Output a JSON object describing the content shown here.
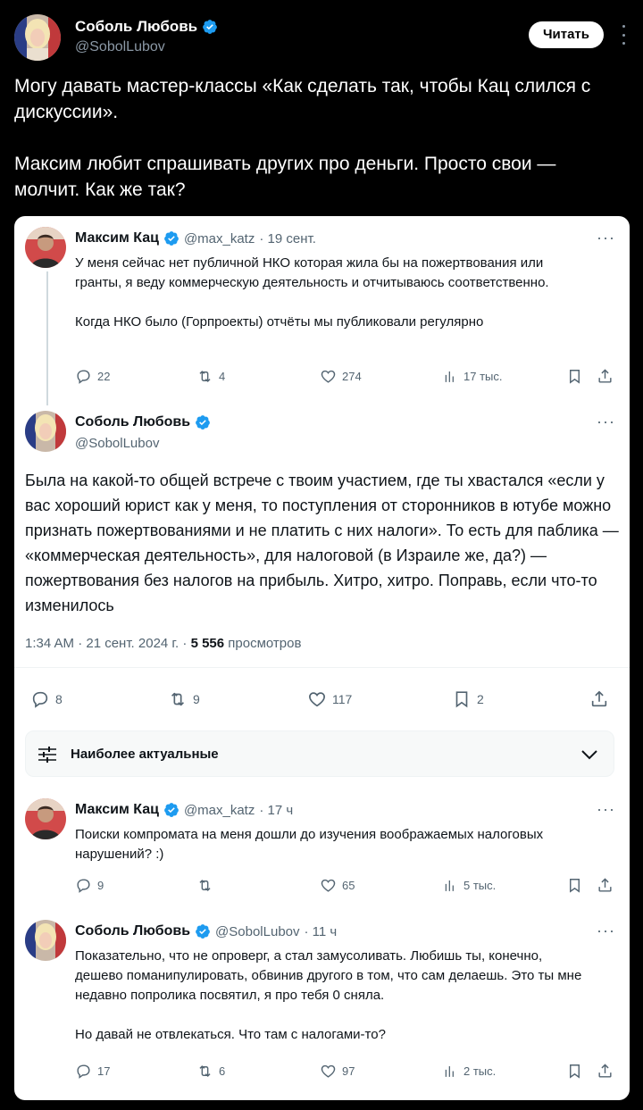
{
  "outer": {
    "author_name": "Соболь Любовь",
    "author_handle": "@SobolLubov",
    "follow_label": "Читать",
    "paragraphs": [
      "Могу давать мастер-классы «Как сделать так, чтобы Кац слился с дискуссии».",
      "Максим любит спрашивать других про деньги. Просто свои — молчит. Как же так?"
    ]
  },
  "screenshot": {
    "tweet1": {
      "name": "Максим Кац",
      "handle": "@max_katz",
      "time": "· 19 сент.",
      "lines": [
        "У меня сейчас нет публичной НКО которая жила бы на пожертвования или гранты, я веду коммерческую деятельность и отчитываюсь соответственно.",
        "Когда НКО было (Горпроекты) отчёты мы публиковали регулярно"
      ],
      "replies": "22",
      "retweets": "4",
      "likes": "274",
      "views": "17 тыс."
    },
    "main": {
      "name": "Соболь Любовь",
      "handle": "@SobolLubov",
      "text": "Была на какой-то общей встрече с твоим участием, где ты хвастался «если у вас хороший юрист как у меня, то поступления от сторонников в ютубе можно признать пожертвованиями и не платить с них налоги». То есть для паблика — «коммерческая деятельность», для налоговой (в Израиле же, да?) — пожертвования без налогов на прибыль. Хитро, хитро. Поправь, если что-то изменилось",
      "timestamp": "1:34 AM · 21 сент. 2024 г. · ",
      "views_count": "5 556",
      "views_label": " просмотров",
      "replies": "8",
      "retweets": "9",
      "likes": "117",
      "bookmarks": "2"
    },
    "sort_label": "Наиболее актуальные",
    "reply1": {
      "name": "Максим Кац",
      "handle": "@max_katz",
      "time": "· 17 ч",
      "text": "Поиски компромата на меня дошли до изучения воображаемых налоговых нарушений? :)",
      "replies": "9",
      "retweets": "",
      "likes": "65",
      "views": "5 тыс."
    },
    "reply2": {
      "name": "Соболь Любовь",
      "handle": "@SobolLubov",
      "time": "· 11 ч",
      "lines": [
        "Показательно, что не опроверг, а стал замусоливать. Любишь ты, конечно, дешево поманипулировать, обвинив другого в том, что сам делаешь. Это ты мне недавно попролика посвятил, я про тебя 0 сняла.",
        "Но давай не отвлекаться. Что там с налогами-то?"
      ],
      "replies": "17",
      "retweets": "6",
      "likes": "97",
      "views": "2 тыс."
    }
  },
  "colors": {
    "verified": "#1d9bf0",
    "text_light": "#e7e9ea",
    "secondary": "#536471"
  }
}
